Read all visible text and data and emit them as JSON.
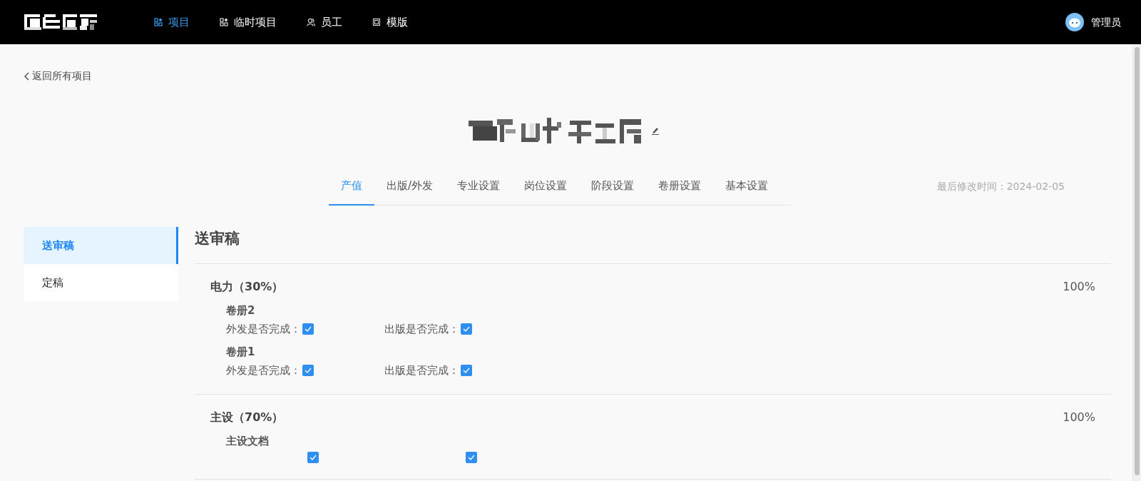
{
  "nav": {
    "items": [
      {
        "label": "项目",
        "selected": true,
        "kind": "grid"
      },
      {
        "label": "临时项目",
        "selected": false,
        "kind": "grid"
      },
      {
        "label": "员工",
        "selected": false,
        "kind": "user"
      },
      {
        "label": "模版",
        "selected": false,
        "kind": "template"
      }
    ]
  },
  "user": {
    "name": "管理员"
  },
  "back_link": "返回所有项目",
  "tabs": [
    {
      "label": "产值",
      "selected": true
    },
    {
      "label": "出版/外发",
      "selected": false
    },
    {
      "label": "专业设置",
      "selected": false
    },
    {
      "label": "岗位设置",
      "selected": false
    },
    {
      "label": "阶段设置",
      "selected": false
    },
    {
      "label": "卷册设置",
      "selected": false
    },
    {
      "label": "基本设置",
      "selected": false
    }
  ],
  "last_modified": "最后修改时间：2024-02-05",
  "sidebar": {
    "items": [
      {
        "label": "送审稿",
        "selected": true
      },
      {
        "label": "定稿",
        "selected": false
      }
    ]
  },
  "section_title": "送审稿",
  "groups": [
    {
      "title": "电力（30%）",
      "value": "100%",
      "volumes": [
        {
          "name": "卷册2",
          "checks": [
            {
              "label": "外发是否完成：",
              "checked": true
            },
            {
              "label": "出版是否完成：",
              "checked": true
            }
          ]
        },
        {
          "name": "卷册1",
          "checks": [
            {
              "label": "外发是否完成：",
              "checked": true
            },
            {
              "label": "出版是否完成：",
              "checked": true
            }
          ]
        }
      ]
    },
    {
      "title": "主设（70%）",
      "value": "100%",
      "volumes": [
        {
          "name": "主设文档",
          "checks": [
            {
              "checked": true
            },
            {
              "checked": true
            }
          ]
        }
      ]
    }
  ]
}
